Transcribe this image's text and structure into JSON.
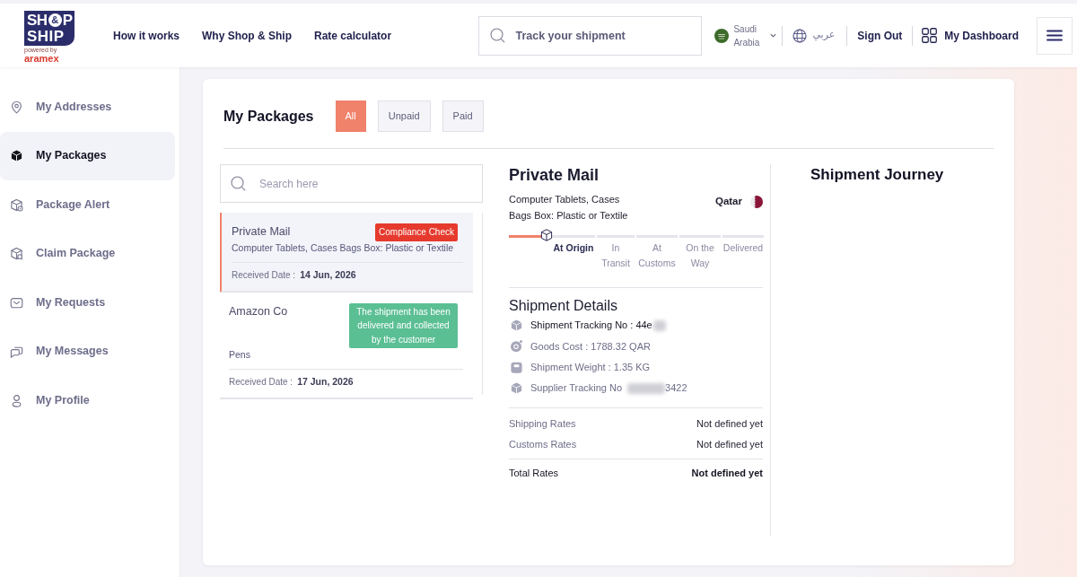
{
  "header": {
    "logo": {
      "text_start": "SH",
      "ampersand": "&",
      "text_end": "P",
      "line_2": "SHIP",
      "tagline": "powered by",
      "brand": "aramex"
    },
    "nav": [
      "How it works",
      "Why Shop & Ship",
      "Rate calculator"
    ],
    "search": {
      "placeholder": "Track your shipment"
    },
    "country": "Saudi Arabia",
    "language": "عربي",
    "sign_out": "Sign Out",
    "dashboard": "My Dashboard"
  },
  "sidebar": {
    "items": [
      {
        "label": "My Addresses",
        "selected": false
      },
      {
        "label": "My Packages",
        "selected": true
      },
      {
        "label": "Package Alert",
        "selected": false
      },
      {
        "label": "Claim Package",
        "selected": false
      },
      {
        "label": "My Requests",
        "selected": false
      },
      {
        "label": "My Messages",
        "selected": false
      },
      {
        "label": "My Profile",
        "selected": false
      }
    ]
  },
  "packages_panel": {
    "title": "My Packages",
    "filters": [
      {
        "label": "All",
        "selected": true
      },
      {
        "label": "Unpaid",
        "selected": false
      },
      {
        "label": "Paid",
        "selected": false
      }
    ],
    "search": {
      "placeholder": "Search here"
    },
    "packages": [
      {
        "name": "Private Mail",
        "status": {
          "label": "Compliance Check",
          "color": "#e53a2d"
        },
        "description": "Computer Tablets, Cases Bags Box: Plastic or Textile",
        "date_label": "Received Date :",
        "date": "14 Jun, 2026",
        "selected": true
      },
      {
        "name": "Amazon Co",
        "status": {
          "label": "The shipment has been delivered and collected by the customer",
          "color": "#5bbf94"
        },
        "description": "Pens",
        "date_label": "Received Date :",
        "date": "17 Jun, 2026",
        "selected": false
      }
    ]
  },
  "shipment": {
    "title": "Private Mail",
    "categories": [
      "Computer Tablets, Cases",
      "Bags Box: Plastic or Textile"
    ],
    "origin_country": "Qatar",
    "progress": {
      "level": 0.13
    },
    "steps": [
      {
        "label": "At Origin",
        "current": true
      },
      {
        "label": "In Transit",
        "current": false
      },
      {
        "label": "At Customs",
        "current": false
      },
      {
        "label": "On the Way",
        "current": false
      },
      {
        "label": "Delivered",
        "current": false
      }
    ],
    "details_title": "Shipment Details",
    "details": [
      {
        "kind": "tracking",
        "text": "Shipment Tracking No : 44e",
        "highlighted": true,
        "redacted": true
      },
      {
        "kind": "cost",
        "text": "Goods Cost : 1788.32 QAR",
        "highlighted": false,
        "redacted": false
      },
      {
        "kind": "weight",
        "text": "Shipment Weight : 1.35 KG",
        "highlighted": false,
        "redacted": false
      },
      {
        "kind": "tracking",
        "text": "Supplier Tracking No",
        "highlighted": false,
        "redacted": true,
        "suffix": "3422"
      }
    ],
    "rates": [
      {
        "kind": "line",
        "label": "Shipping Rates",
        "value": "Not defined yet"
      },
      {
        "kind": "line",
        "label": "Customs Rates",
        "value": "Not defined yet"
      },
      {
        "kind": "total",
        "label": "Total Rates",
        "value": "Not defined yet"
      }
    ]
  },
  "journey": {
    "title": "Shipment Journey"
  }
}
